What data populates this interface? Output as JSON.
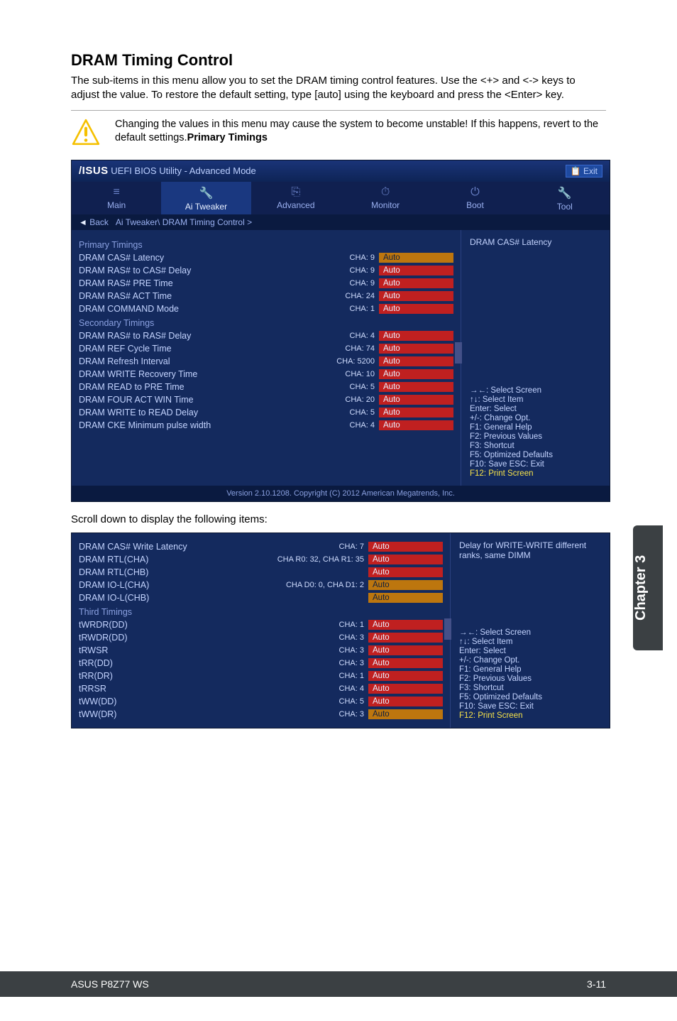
{
  "title": "DRAM Timing Control",
  "desc": "The sub-items in this menu allow you to set the DRAM timing control features. Use the <+> and <-> keys to adjust the value. To restore the default setting, type [auto] using the keyboard and press the <Enter> key.",
  "alert": "Changing the values in this menu may cause the system to become unstable! If this happens, revert to the default settings.",
  "alert_bold": "Primary Timings",
  "bios": {
    "brand": "/ISUS",
    "title_rest": " UEFI BIOS Utility - Advanced Mode",
    "exit": "Exit",
    "tabs": [
      "Main",
      "Ai Tweaker",
      "Advanced",
      "Monitor",
      "Boot",
      "Tool"
    ],
    "active_tab": 1,
    "back": "Back",
    "breadcrumb": "Ai Tweaker\\ DRAM Timing Control >",
    "sections1": [
      {
        "header": "Primary Timings",
        "rows": [
          {
            "lbl": "DRAM CAS# Latency",
            "ch": "CHA: 9",
            "val": "Auto",
            "gold": true
          },
          {
            "lbl": "DRAM RAS# to CAS# Delay",
            "ch": "CHA: 9",
            "val": "Auto"
          },
          {
            "lbl": "DRAM RAS# PRE Time",
            "ch": "CHA: 9",
            "val": "Auto"
          },
          {
            "lbl": "DRAM RAS# ACT Time",
            "ch": "CHA: 24",
            "val": "Auto"
          },
          {
            "lbl": "DRAM COMMAND Mode",
            "ch": "CHA: 1",
            "val": "Auto"
          }
        ]
      },
      {
        "header": "Secondary Timings",
        "rows": [
          {
            "lbl": "DRAM RAS# to RAS# Delay",
            "ch": "CHA: 4",
            "val": "Auto"
          },
          {
            "lbl": "DRAM REF Cycle Time",
            "ch": "CHA: 74",
            "val": "Auto"
          },
          {
            "lbl": "DRAM Refresh Interval",
            "ch": "CHA: 5200",
            "val": "Auto"
          },
          {
            "lbl": "DRAM WRITE Recovery Time",
            "ch": "CHA: 10",
            "val": "Auto"
          },
          {
            "lbl": "DRAM READ to PRE Time",
            "ch": "CHA: 5",
            "val": "Auto"
          },
          {
            "lbl": "DRAM FOUR ACT WIN Time",
            "ch": "CHA: 20",
            "val": "Auto"
          },
          {
            "lbl": "DRAM WRITE to READ Delay",
            "ch": "CHA: 5",
            "val": "Auto"
          },
          {
            "lbl": "DRAM CKE Minimum pulse width",
            "ch": "CHA: 4",
            "val": "Auto"
          }
        ]
      }
    ],
    "side1_title": "DRAM CAS# Latency",
    "help": [
      {
        "t": "→←: Select Screen"
      },
      {
        "t": "↑↓: Select Item"
      },
      {
        "t": "Enter: Select"
      },
      {
        "t": "+/-: Change Opt."
      },
      {
        "t": "F1: General Help"
      },
      {
        "t": "F2: Previous Values"
      },
      {
        "t": "F3: Shortcut"
      },
      {
        "t": "F5: Optimized Defaults"
      },
      {
        "t": "F10: Save  ESC: Exit"
      },
      {
        "t": "F12: Print Screen",
        "y": true
      }
    ],
    "footer": "Version 2.10.1208. Copyright (C) 2012 American Megatrends, Inc."
  },
  "scroll_text": "Scroll down to display the following items:",
  "bios2": {
    "rows": [
      {
        "lbl": "DRAM CAS# Write Latency",
        "ch": "CHA: 7",
        "val": "Auto"
      },
      {
        "lbl": "DRAM RTL(CHA)",
        "ch": "CHA R0: 32, CHA R1: 35",
        "val": "Auto"
      },
      {
        "lbl": "DRAM RTL(CHB)",
        "ch": "",
        "val": "Auto"
      },
      {
        "lbl": "DRAM IO-L(CHA)",
        "ch": "CHA D0: 0, CHA D1: 2",
        "val": "Auto",
        "gold": false,
        "red": false,
        "goldbox": true
      },
      {
        "lbl": "DRAM IO-L(CHB)",
        "ch": "",
        "val": "Auto",
        "goldbox": true
      }
    ],
    "third_header": "Third Timings",
    "third_rows": [
      {
        "lbl": "tWRDR(DD)",
        "ch": "CHA: 1",
        "val": "Auto"
      },
      {
        "lbl": "tRWDR(DD)",
        "ch": "CHA: 3",
        "val": "Auto"
      },
      {
        "lbl": "tRWSR",
        "ch": "CHA: 3",
        "val": "Auto"
      },
      {
        "lbl": "tRR(DD)",
        "ch": "CHA: 3",
        "val": "Auto"
      },
      {
        "lbl": "tRR(DR)",
        "ch": "CHA: 1",
        "val": "Auto"
      },
      {
        "lbl": "tRRSR",
        "ch": "CHA: 4",
        "val": "Auto"
      },
      {
        "lbl": "tWW(DD)",
        "ch": "CHA: 5",
        "val": "Auto"
      },
      {
        "lbl": "tWW(DR)",
        "ch": "CHA: 3",
        "val": "Auto",
        "gold": true
      }
    ],
    "side2_title": "Delay for WRITE-WRITE different ranks, same DIMM",
    "help2": [
      {
        "t": "→←: Select Screen"
      },
      {
        "t": "↑↓: Select Item"
      },
      {
        "t": "Enter: Select"
      },
      {
        "t": "+/-: Change Opt."
      },
      {
        "t": "F1: General Help"
      },
      {
        "t": "F2: Previous Values"
      },
      {
        "t": "F3: Shortcut"
      },
      {
        "t": "F5: Optimized Defaults"
      },
      {
        "t": "F10: Save  ESC: Exit"
      },
      {
        "t": "F12: Print Screen",
        "y": true
      }
    ]
  },
  "chapter_tab": "Chapter 3",
  "footer_left": "ASUS P8Z77 WS",
  "footer_right": "3-11"
}
